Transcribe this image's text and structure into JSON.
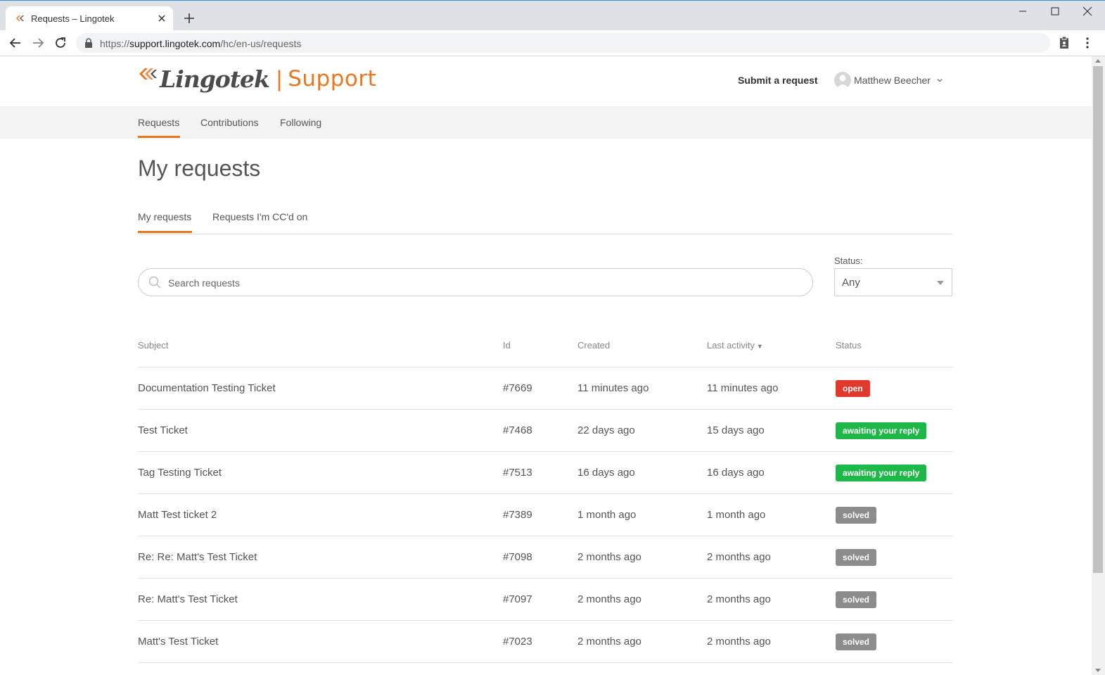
{
  "browser": {
    "tab_title": "Requests – Lingotek",
    "url_scheme": "https://",
    "url_host": "support.lingotek.com",
    "url_path": "/hc/en-us/requests"
  },
  "header": {
    "logo_word": "Lingotek",
    "logo_sep": "|",
    "logo_support": "Support",
    "submit_label": "Submit a request",
    "user_name": "Matthew Beecher"
  },
  "subnav": {
    "items": [
      {
        "label": "Requests"
      },
      {
        "label": "Contributions"
      },
      {
        "label": "Following"
      }
    ]
  },
  "main": {
    "title": "My requests",
    "tabs": [
      {
        "label": "My requests"
      },
      {
        "label": "Requests I'm CC'd on"
      }
    ],
    "search_placeholder": "Search requests",
    "status_label": "Status:",
    "status_value": "Any"
  },
  "table": {
    "headers": {
      "subject": "Subject",
      "id": "Id",
      "created": "Created",
      "activity": "Last activity",
      "status": "Status"
    },
    "sort_indicator": "▼",
    "rows": [
      {
        "subject": "Documentation Testing Ticket",
        "id": "#7669",
        "created": "11 minutes ago",
        "activity": "11 minutes ago",
        "status": "open",
        "status_color": "#e03a2f"
      },
      {
        "subject": "Test Ticket",
        "id": "#7468",
        "created": "22 days ago",
        "activity": "15 days ago",
        "status": "awaiting your reply",
        "status_color": "#1eb848"
      },
      {
        "subject": "Tag Testing Ticket",
        "id": "#7513",
        "created": "16 days ago",
        "activity": "16 days ago",
        "status": "awaiting your reply",
        "status_color": "#1eb848"
      },
      {
        "subject": "Matt Test ticket 2",
        "id": "#7389",
        "created": "1 month ago",
        "activity": "1 month ago",
        "status": "solved",
        "status_color": "#8c8c8c"
      },
      {
        "subject": "Re: Re: Matt's Test Ticket",
        "id": "#7098",
        "created": "2 months ago",
        "activity": "2 months ago",
        "status": "solved",
        "status_color": "#8c8c8c"
      },
      {
        "subject": "Re: Matt's Test Ticket",
        "id": "#7097",
        "created": "2 months ago",
        "activity": "2 months ago",
        "status": "solved",
        "status_color": "#8c8c8c"
      },
      {
        "subject": "Matt's Test Ticket",
        "id": "#7023",
        "created": "2 months ago",
        "activity": "2 months ago",
        "status": "solved",
        "status_color": "#8c8c8c"
      }
    ]
  },
  "colors": {
    "accent": "#e87722",
    "open": "#e03a2f",
    "awaiting": "#1eb848",
    "solved": "#8c8c8c"
  }
}
